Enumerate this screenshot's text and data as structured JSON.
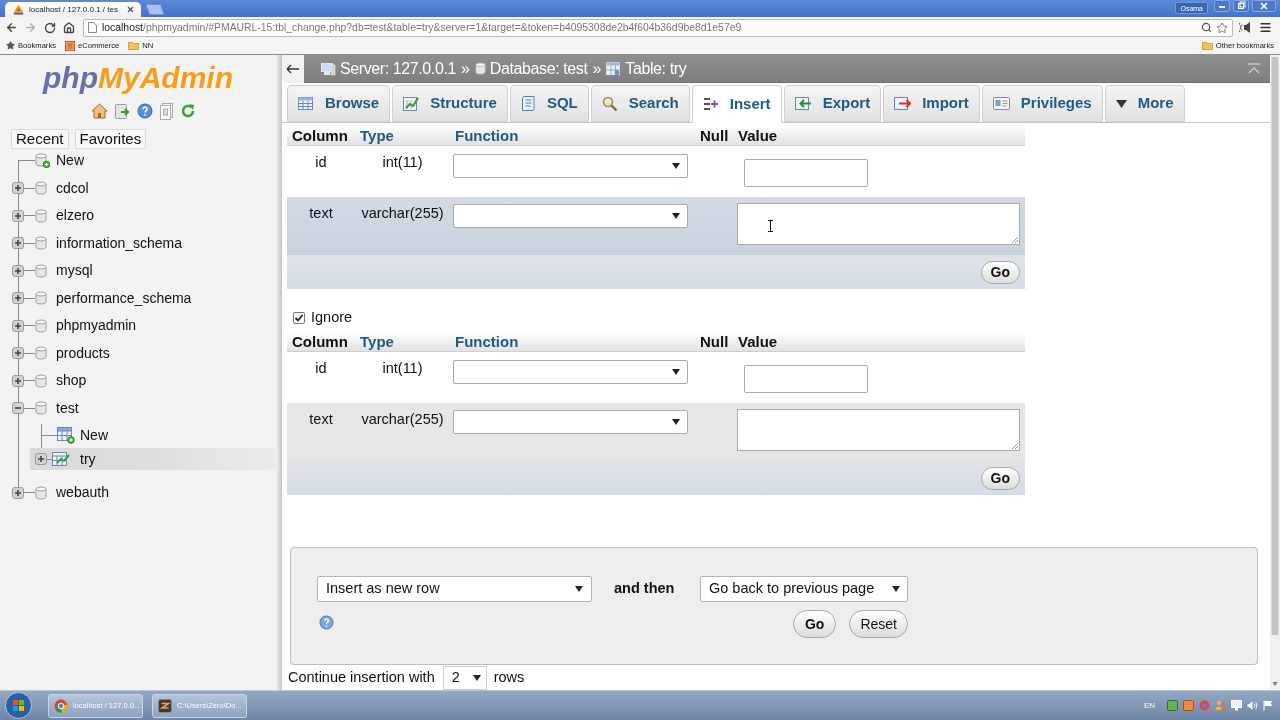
{
  "browser": {
    "tab_title": "localhost / 127.0.0.1 / tes",
    "profile": "Osama",
    "url_host": "localhost",
    "url_rest": "/phpmyadmin/#PMAURL-15:tbl_change.php?db=test&table=try&server=1&target=&token=b4095308de2b4f604b36d9be8d1e57e9",
    "bookmarks": [
      {
        "kind": "star",
        "label": "Bookmarks"
      },
      {
        "kind": "site",
        "label": "eCommerce"
      },
      {
        "kind": "folder",
        "label": "NN"
      }
    ],
    "other_bookmarks": "Other bookmarks"
  },
  "sidebar": {
    "logo": [
      "php",
      "MyAdmin"
    ],
    "tabs": [
      "Recent",
      "Favorites"
    ],
    "tree": [
      {
        "kind": "new_db",
        "label": "New",
        "selected": false
      },
      {
        "kind": "db",
        "label": "cdcol",
        "expanded": false,
        "selected": false
      },
      {
        "kind": "db",
        "label": "elzero",
        "expanded": false,
        "selected": false
      },
      {
        "kind": "db",
        "label": "information_schema",
        "expanded": false,
        "selected": false
      },
      {
        "kind": "db",
        "label": "mysql",
        "expanded": false,
        "selected": false
      },
      {
        "kind": "db",
        "label": "performance_schema",
        "expanded": false,
        "selected": false
      },
      {
        "kind": "db",
        "label": "phpmyadmin",
        "expanded": false,
        "selected": false
      },
      {
        "kind": "db",
        "label": "products",
        "expanded": false,
        "selected": false
      },
      {
        "kind": "db",
        "label": "shop",
        "expanded": false,
        "selected": false
      },
      {
        "kind": "db",
        "label": "test",
        "expanded": true,
        "selected": false,
        "children": [
          {
            "kind": "new_table",
            "label": "New",
            "selected": false
          },
          {
            "kind": "table",
            "label": "try",
            "expanded": false,
            "selected": true
          }
        ]
      },
      {
        "kind": "db",
        "label": "webauth",
        "expanded": false,
        "selected": false
      }
    ]
  },
  "breadcrumb": [
    {
      "kind": "server",
      "label": "Server: 127.0.0.1",
      "separator": "»"
    },
    {
      "kind": "database",
      "label": "Database: test",
      "separator": "»"
    },
    {
      "kind": "table",
      "label": "Table: try"
    }
  ],
  "tabs": [
    {
      "kind": "browse",
      "label": "Browse",
      "selected": false
    },
    {
      "kind": "structure",
      "label": "Structure",
      "selected": false
    },
    {
      "kind": "sql",
      "label": "SQL",
      "selected": false
    },
    {
      "kind": "search",
      "label": "Search",
      "selected": false
    },
    {
      "kind": "insert",
      "label": "Insert",
      "selected": true
    },
    {
      "kind": "export",
      "label": "Export",
      "selected": false
    },
    {
      "kind": "import",
      "label": "Import",
      "selected": false
    },
    {
      "kind": "privileges",
      "label": "Privileges",
      "selected": false
    },
    {
      "kind": "more",
      "label": "More",
      "selected": false
    }
  ],
  "insert_forms": [
    {
      "headers": [
        {
          "label": "Column",
          "kind": "text"
        },
        {
          "label": "Type",
          "kind": "link"
        },
        {
          "label": "Function",
          "kind": "link"
        },
        {
          "label": "Null",
          "kind": "text"
        },
        {
          "label": "Value",
          "kind": "text"
        }
      ],
      "rows": [
        {
          "column": "id",
          "type": "int(11)",
          "kind": "input",
          "hovered": false
        },
        {
          "column": "text",
          "type": "varchar(255)",
          "kind": "textarea",
          "hovered": true
        }
      ],
      "go": "Go"
    },
    {
      "ignore": {
        "label": "Ignore",
        "checked": true
      },
      "headers": [
        {
          "label": "Column",
          "kind": "text"
        },
        {
          "label": "Type",
          "kind": "link"
        },
        {
          "label": "Function",
          "kind": "link"
        },
        {
          "label": "Null",
          "kind": "text"
        },
        {
          "label": "Value",
          "kind": "text"
        }
      ],
      "rows": [
        {
          "column": "id",
          "type": "int(11)",
          "kind": "input",
          "hovered": false
        },
        {
          "column": "text",
          "type": "varchar(255)",
          "kind": "textarea",
          "hovered": false
        }
      ],
      "go": "Go"
    }
  ],
  "after_insert": {
    "action": "Insert as new row",
    "joiner": "and then",
    "next": "Go back to previous page",
    "go": "Go",
    "reset": "Reset"
  },
  "continue": {
    "label": "Continue insertion with",
    "count": "2",
    "suffix": "rows"
  },
  "taskbar": {
    "items": [
      {
        "kind": "browser",
        "label": "localhost / 127.0.0..."
      },
      {
        "kind": "editor",
        "label": "C:\\Users\\Zero\\Do..."
      }
    ],
    "language": "EN"
  }
}
